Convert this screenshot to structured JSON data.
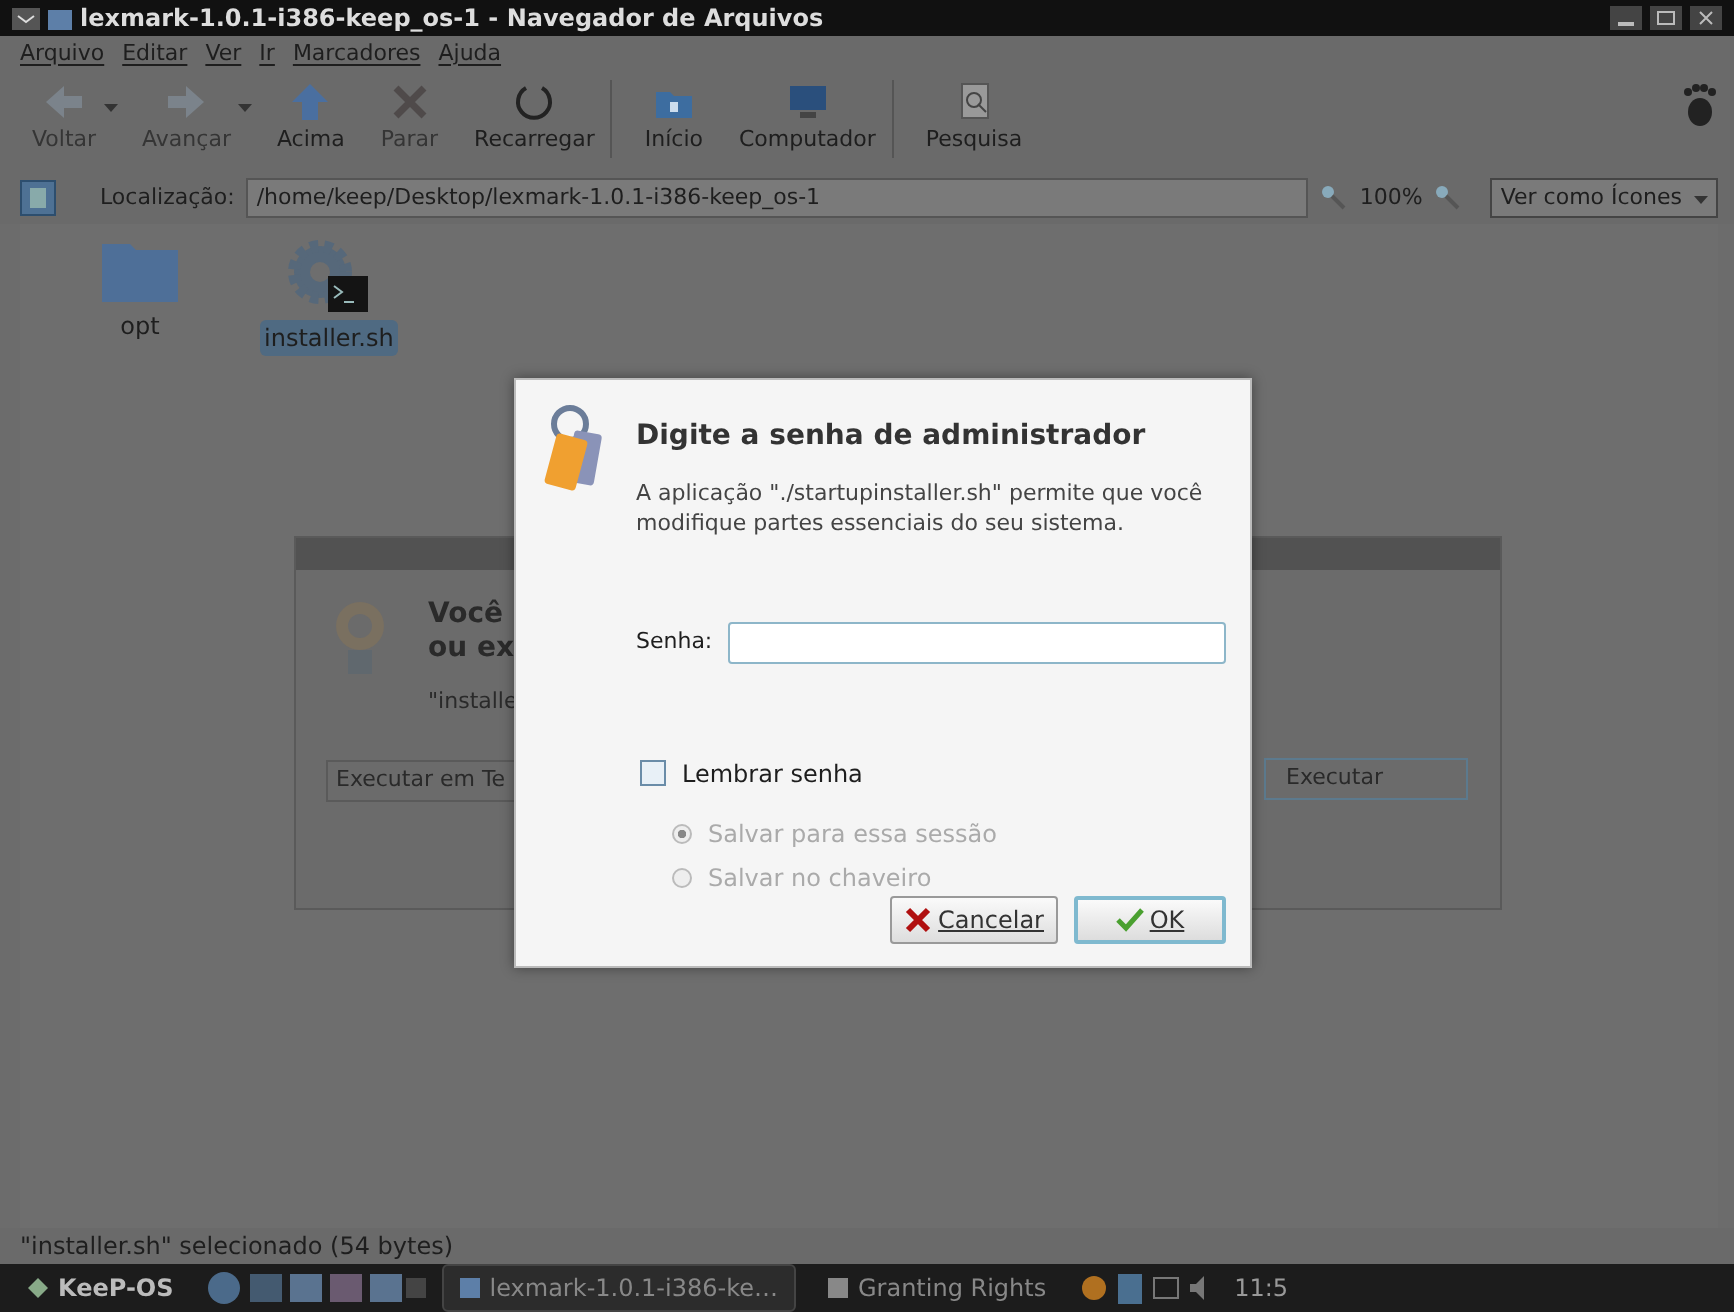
{
  "window": {
    "title": "lexmark-1.0.1-i386-keep_os-1 - Navegador de Arquivos"
  },
  "menu": [
    "Arquivo",
    "Editar",
    "Ver",
    "Ir",
    "Marcadores",
    "Ajuda"
  ],
  "toolbar": [
    {
      "kind": "back",
      "label": "Voltar",
      "disabled": true,
      "dropdown": true,
      "separator_after": false
    },
    {
      "kind": "forward",
      "label": "Avançar",
      "disabled": true,
      "dropdown": true,
      "separator_after": false
    },
    {
      "kind": "up",
      "label": "Acima",
      "disabled": false,
      "dropdown": false,
      "separator_after": false
    },
    {
      "kind": "stop",
      "label": "Parar",
      "disabled": true,
      "dropdown": false,
      "separator_after": false
    },
    {
      "kind": "reload",
      "label": "Recarregar",
      "disabled": false,
      "dropdown": false,
      "separator_after": true
    },
    {
      "kind": "home",
      "label": "Início",
      "disabled": false,
      "dropdown": false,
      "separator_after": false
    },
    {
      "kind": "computer",
      "label": "Computador",
      "disabled": false,
      "dropdown": false,
      "separator_after": true
    },
    {
      "kind": "search",
      "label": "Pesquisa",
      "disabled": false,
      "dropdown": false,
      "separator_after": false
    }
  ],
  "location": {
    "label": "Localização:",
    "value": "/home/keep/Desktop/lexmark-1.0.1-i386-keep_os-1",
    "zoom": "100%",
    "view": "Ver como Ícones"
  },
  "files": [
    {
      "name": "opt",
      "kind": "folder",
      "selected": false
    },
    {
      "name": "installer.sh",
      "kind": "script",
      "selected": true
    }
  ],
  "background_dialog": {
    "heading_1": "Você",
    "heading_2": "ou ex",
    "detail": "\"installe",
    "left_button": "Executar em Te",
    "right_button": "Executar"
  },
  "auth_dialog": {
    "title": "Digite a senha de administrador",
    "message": "A aplicação \"./startupinstaller.sh\" permite que você modifique partes essenciais do seu sistema.",
    "password_label": "Senha:",
    "remember": {
      "label": "Lembrar senha",
      "checked": false
    },
    "save_options": [
      {
        "label": "Salvar para essa sessão",
        "selected": true,
        "disabled": true
      },
      {
        "label": "Salvar no chaveiro",
        "selected": false,
        "disabled": true
      }
    ],
    "buttons": [
      {
        "kind": "cancel",
        "label": "Cancelar",
        "default": false
      },
      {
        "kind": "ok",
        "label": "OK",
        "default": true
      }
    ]
  },
  "status_bar": "\"installer.sh\" selecionado (54 bytes)",
  "taskbar": {
    "start": "KeeP-OS",
    "tasks": [
      {
        "label": "lexmark-1.0.1-i386-ke…",
        "selected": true
      },
      {
        "label": "Granting Rights",
        "selected": false
      }
    ],
    "clock": "11:5"
  }
}
